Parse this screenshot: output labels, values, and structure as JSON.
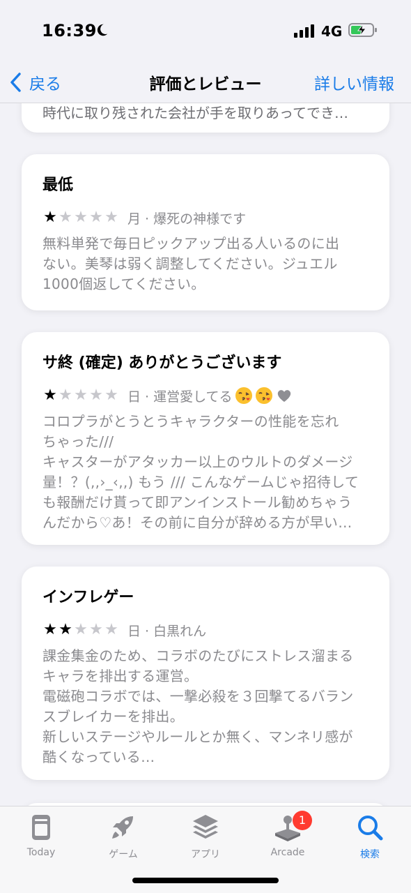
{
  "status": {
    "time": "16:39",
    "network": "4G"
  },
  "nav": {
    "back_label": "戻る",
    "title": "評価とレビュー",
    "details_label": "詳しい情報"
  },
  "partial_review": {
    "body": "時代に取り残された会社が手を取りあってでき…"
  },
  "reviews": [
    {
      "title": "最低",
      "rating": 1,
      "reviewer": "月 · 爆死の神様です",
      "body": "無料単発で毎日ピックアップ出る人いるのに出\nない。美琴は弱く調整してください。ジュエル\n1000個返してください。"
    },
    {
      "title": "サ終 (確定) ありがとうございます",
      "rating": 1,
      "reviewer": "日 · 運営愛してる",
      "reviewer_emoji": [
        "kiss-emoji",
        "kiss-emoji",
        "gray-heart"
      ],
      "body": "コロプラがとうとうキャラクターの性能を忘れ\nちゃった///\nキャスターがアタッカー以上のウルトのダメージ\n量！？(,,›_‹,,) もう /// こんなゲームじゃ招待して\nも報酬だけ貰って即アンインストール勧めちゃう\nんだから♡あ！その前に自分が辞める方が早い…"
    },
    {
      "title": "インフレゲー",
      "rating": 2,
      "reviewer": "日 · 白黒れん",
      "body": "課金集金のため、コラボのたびにストレス溜まる\nキャラを排出する運営。\n電磁砲コラボでは、一撃必殺を３回撃てるバラン\nスブレイカーを排出。\n新しいステージやルールとか無く、マンネリ感が\n酷くなっている…"
    }
  ],
  "tabs": [
    {
      "label": "Today",
      "icon": "today-icon"
    },
    {
      "label": "ゲーム",
      "icon": "rocket-icon"
    },
    {
      "label": "アプリ",
      "icon": "layers-icon"
    },
    {
      "label": "Arcade",
      "icon": "joystick-icon",
      "badge": "1"
    },
    {
      "label": "検索",
      "icon": "search-icon",
      "active": true
    }
  ],
  "colors": {
    "accent": "#1a7ce8",
    "badge": "#ff3b30",
    "secondary_text": "#8a8a8e"
  }
}
